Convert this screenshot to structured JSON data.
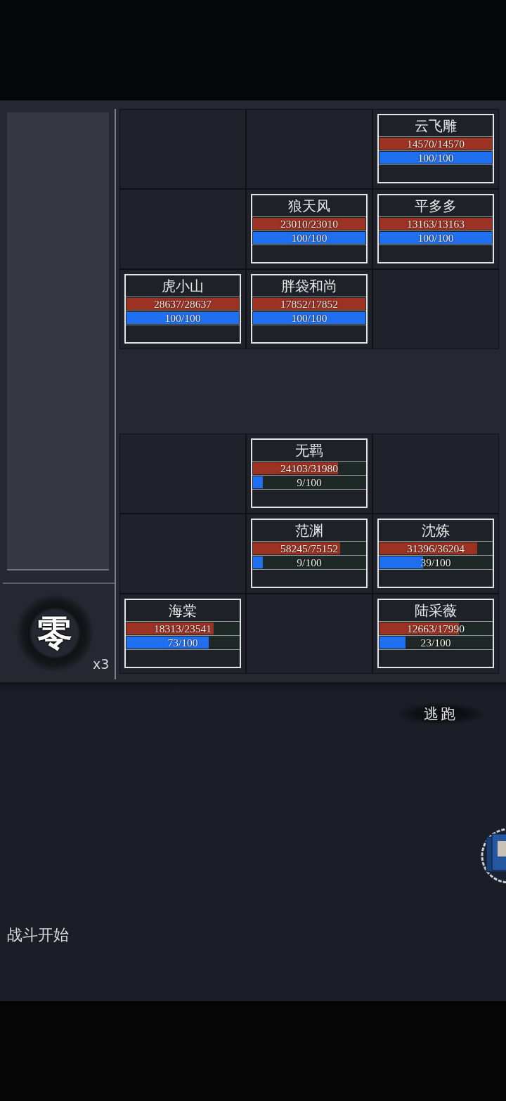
{
  "side_panel": {
    "skill": {
      "label": "零",
      "count": "x3"
    }
  },
  "enemy_grid": {
    "cells": [
      {
        "kind": "empty"
      },
      {
        "kind": "empty"
      },
      {
        "kind": "unit",
        "name": "云飞雕",
        "hp": {
          "reading": "14570/14570",
          "level": 1
        },
        "mp": {
          "reading": "100/100",
          "level": 1
        }
      },
      {
        "kind": "empty"
      },
      {
        "kind": "unit",
        "name": "狼天风",
        "hp": {
          "reading": "23010/23010",
          "level": 1
        },
        "mp": {
          "reading": "100/100",
          "level": 1
        }
      },
      {
        "kind": "unit",
        "name": "平多多",
        "hp": {
          "reading": "13163/13163",
          "level": 1
        },
        "mp": {
          "reading": "100/100",
          "level": 1
        }
      },
      {
        "kind": "unit",
        "name": "虎小山",
        "hp": {
          "reading": "28637/28637",
          "level": 1
        },
        "mp": {
          "reading": "100/100",
          "level": 1
        }
      },
      {
        "kind": "unit",
        "name": "胖袋和尚",
        "hp": {
          "reading": "17852/17852",
          "level": 1
        },
        "mp": {
          "reading": "100/100",
          "level": 1
        }
      },
      {
        "kind": "empty"
      }
    ]
  },
  "player_grid": {
    "cells": [
      {
        "kind": "empty"
      },
      {
        "kind": "unit",
        "name": "无羁",
        "hp": {
          "reading": "24103/31980",
          "level": 0.754
        },
        "mp": {
          "reading": "9/100",
          "level": 0.09
        }
      },
      {
        "kind": "empty"
      },
      {
        "kind": "empty"
      },
      {
        "kind": "unit",
        "name": "范渊",
        "hp": {
          "reading": "58245/75152",
          "level": 0.775
        },
        "mp": {
          "reading": "9/100",
          "level": 0.09
        }
      },
      {
        "kind": "unit",
        "name": "沈炼",
        "hp": {
          "reading": "31396/36204",
          "level": 0.867
        },
        "mp": {
          "reading": "39/100",
          "level": 0.39
        }
      },
      {
        "kind": "unit",
        "name": "海棠",
        "hp": {
          "reading": "18313/23541",
          "level": 0.778
        },
        "mp": {
          "reading": "73/100",
          "level": 0.73
        }
      },
      {
        "kind": "empty"
      },
      {
        "kind": "unit",
        "name": "陆采薇",
        "hp": {
          "reading": "12663/17990",
          "level": 0.704
        },
        "mp": {
          "reading": "23/100",
          "level": 0.23
        }
      }
    ]
  },
  "escape_button": "逃跑",
  "battle_log": [
    "战斗开始"
  ]
}
